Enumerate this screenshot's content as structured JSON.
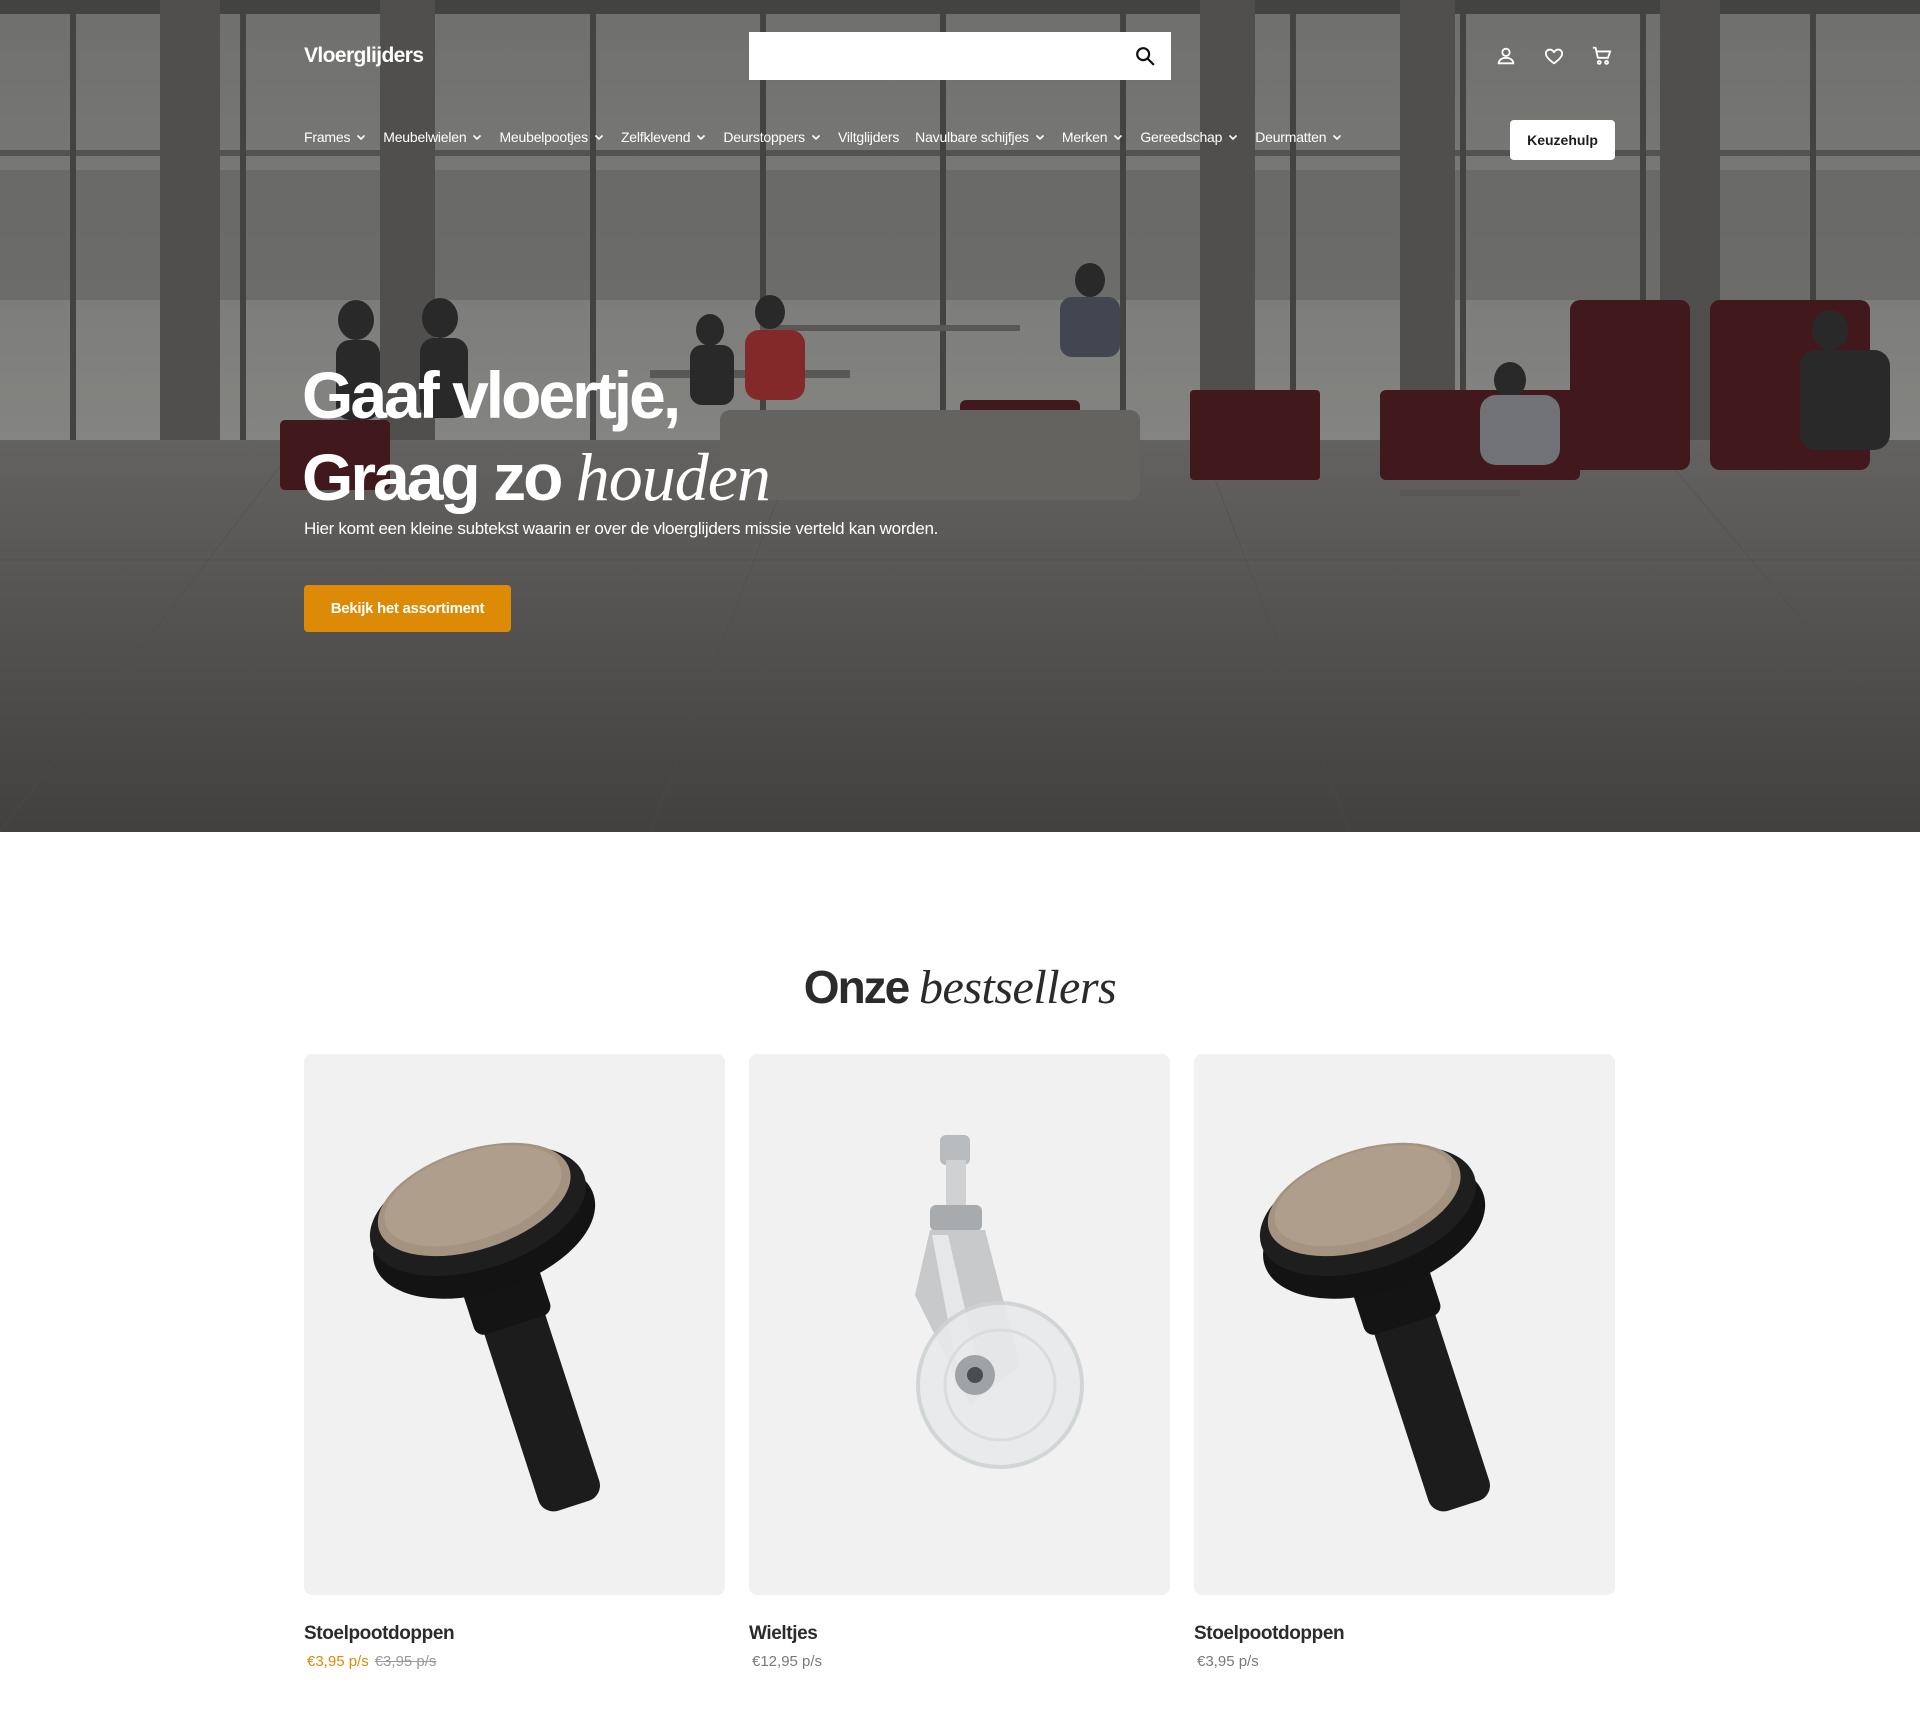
{
  "header": {
    "logo": "Vloerglijders",
    "search": {
      "placeholder": "",
      "value": ""
    },
    "icons": [
      "user-icon",
      "heart-icon",
      "cart-icon",
      "search-icon"
    ]
  },
  "nav": {
    "items": [
      {
        "label": "Frames",
        "has_dropdown": true
      },
      {
        "label": "Meubelwielen",
        "has_dropdown": true
      },
      {
        "label": "Meubelpootjes",
        "has_dropdown": true
      },
      {
        "label": "Zelfklevend",
        "has_dropdown": true
      },
      {
        "label": "Deurstoppers",
        "has_dropdown": true
      },
      {
        "label": "Viltglijders",
        "has_dropdown": false
      },
      {
        "label": "Navulbare schijfjes",
        "has_dropdown": true
      },
      {
        "label": "Merken",
        "has_dropdown": true
      },
      {
        "label": "Gereedschap",
        "has_dropdown": true
      },
      {
        "label": "Deurmatten",
        "has_dropdown": true
      }
    ],
    "keuzehulp_label": "Keuzehulp"
  },
  "hero": {
    "title_line1": "Gaaf vloertje,",
    "title_line2_regular": "Graag zo",
    "title_line2_italic": "houden",
    "subtext": "Hier komt een kleine subtekst waarin er over de vloerglijders missie verteld kan worden.",
    "cta_label": "Bekijk het assortiment"
  },
  "bestsellers": {
    "title_regular": "Onze",
    "title_italic": "bestsellers",
    "products": [
      {
        "name": "Stoelpootdoppen",
        "price": "€3,95 p/s",
        "old_price": "€3,95 p/s",
        "on_sale": true,
        "image": "felt-glider"
      },
      {
        "name": "Wieltjes",
        "price": "€12,95 p/s",
        "old_price": "",
        "on_sale": false,
        "image": "caster-wheel"
      },
      {
        "name": "Stoelpootdoppen",
        "price": "€3,95 p/s",
        "old_price": "",
        "on_sale": false,
        "image": "felt-glider"
      }
    ]
  },
  "colors": {
    "accent": "#dd8a06",
    "text_dark": "#2b2b2b",
    "card_bg": "#f1f1f1",
    "price_grey": "#7a7a7a"
  }
}
